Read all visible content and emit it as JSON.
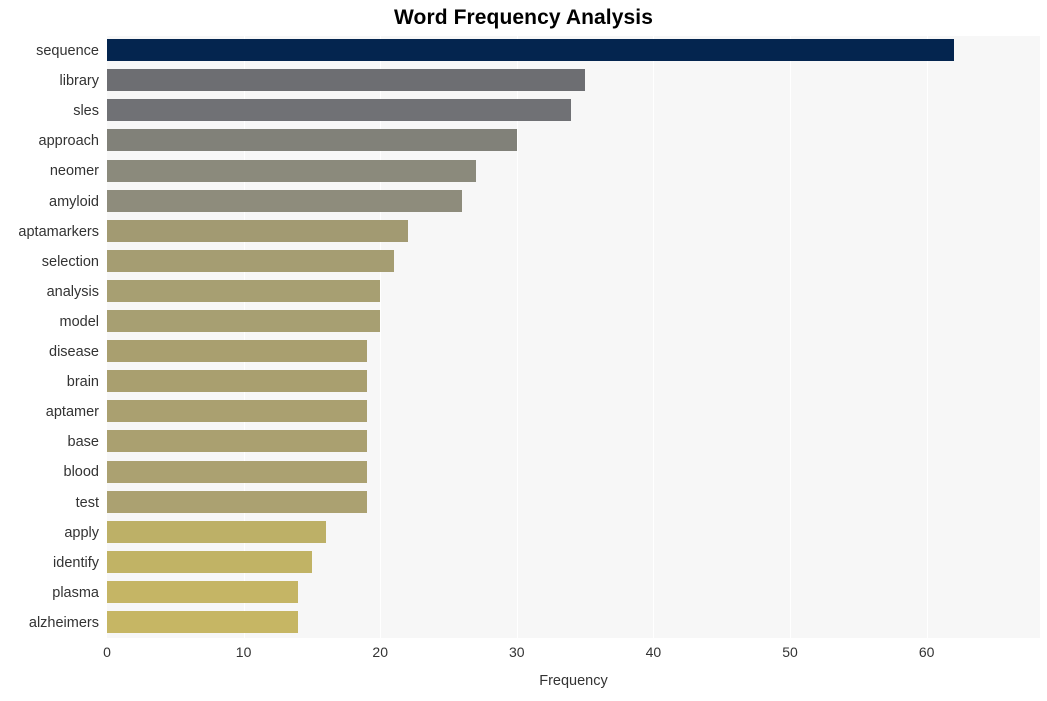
{
  "chart_data": {
    "type": "bar",
    "orientation": "horizontal",
    "title": "Word Frequency Analysis",
    "xlabel": "Frequency",
    "ylabel": "",
    "categories": [
      "sequence",
      "library",
      "sles",
      "approach",
      "neomer",
      "amyloid",
      "aptamarkers",
      "selection",
      "analysis",
      "model",
      "disease",
      "brain",
      "aptamer",
      "base",
      "blood",
      "test",
      "apply",
      "identify",
      "plasma",
      "alzheimers"
    ],
    "values": [
      62,
      35,
      34,
      30,
      27,
      26,
      22,
      21,
      20,
      20,
      19,
      19,
      19,
      19,
      19,
      19,
      16,
      15,
      14,
      14
    ],
    "bar_colors": [
      "#04254f",
      "#6d6e72",
      "#707175",
      "#818179",
      "#8b8a7c",
      "#8e8c7c",
      "#a29a72",
      "#a59d72",
      "#a79f72",
      "#a79f72",
      "#a99f6f",
      "#a99f6f",
      "#aaa070",
      "#aaa070",
      "#aba171",
      "#aba171",
      "#bdb067",
      "#c1b365",
      "#c5b565",
      "#c6b664"
    ],
    "xlim": [
      0,
      68.3
    ],
    "xticks": [
      0,
      10,
      20,
      30,
      40,
      50,
      60
    ],
    "xtick_labels": [
      "0",
      "10",
      "20",
      "30",
      "40",
      "50",
      "60"
    ],
    "grid": "vertical",
    "legend": "none",
    "plot_background": "#f7f7f7",
    "figure_background": "#ffffff",
    "gridline_color": "#ffffff"
  }
}
